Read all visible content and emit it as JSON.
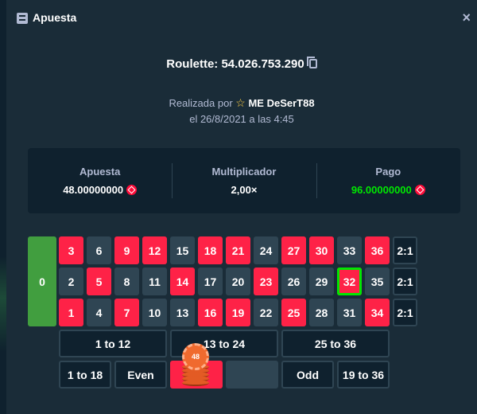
{
  "header": {
    "title": "Apuesta",
    "close_symbol": "×"
  },
  "game": {
    "line": "Roulette: 54.026.753.290"
  },
  "placed": {
    "prefix": "Realizada por",
    "user": "ME DeSerT88",
    "date": "el 26/8/2021 a las 4:45"
  },
  "stats": {
    "bet": {
      "label": "Apuesta",
      "value": "48.00000000"
    },
    "multiplier": {
      "label": "Multiplicador",
      "value": "2,00×"
    },
    "payout": {
      "label": "Pago",
      "value": "96.00000000"
    }
  },
  "table": {
    "zero": "0",
    "rows": [
      [
        {
          "n": "3",
          "c": "red"
        },
        {
          "n": "6",
          "c": "black"
        },
        {
          "n": "9",
          "c": "red"
        },
        {
          "n": "12",
          "c": "red"
        },
        {
          "n": "15",
          "c": "black"
        },
        {
          "n": "18",
          "c": "red"
        },
        {
          "n": "21",
          "c": "red"
        },
        {
          "n": "24",
          "c": "black"
        },
        {
          "n": "27",
          "c": "red"
        },
        {
          "n": "30",
          "c": "red"
        },
        {
          "n": "33",
          "c": "black"
        },
        {
          "n": "36",
          "c": "red"
        }
      ],
      [
        {
          "n": "2",
          "c": "black"
        },
        {
          "n": "5",
          "c": "red"
        },
        {
          "n": "8",
          "c": "black"
        },
        {
          "n": "11",
          "c": "black"
        },
        {
          "n": "14",
          "c": "red"
        },
        {
          "n": "17",
          "c": "black"
        },
        {
          "n": "20",
          "c": "black"
        },
        {
          "n": "23",
          "c": "red"
        },
        {
          "n": "26",
          "c": "black"
        },
        {
          "n": "29",
          "c": "black"
        },
        {
          "n": "32",
          "c": "red",
          "hit": true
        },
        {
          "n": "35",
          "c": "black"
        }
      ],
      [
        {
          "n": "1",
          "c": "red"
        },
        {
          "n": "4",
          "c": "black"
        },
        {
          "n": "7",
          "c": "red"
        },
        {
          "n": "10",
          "c": "black"
        },
        {
          "n": "13",
          "c": "black"
        },
        {
          "n": "16",
          "c": "red"
        },
        {
          "n": "19",
          "c": "red"
        },
        {
          "n": "22",
          "c": "black"
        },
        {
          "n": "25",
          "c": "red"
        },
        {
          "n": "28",
          "c": "black"
        },
        {
          "n": "31",
          "c": "black"
        },
        {
          "n": "34",
          "c": "red"
        }
      ]
    ],
    "column_label": "2:1",
    "dozens": [
      "1 to 12",
      "13 to 24",
      "25 to 36"
    ],
    "outside": [
      "1 to 18",
      "Even",
      "",
      "",
      "Odd",
      "19 to 36"
    ],
    "chip_value": "48"
  },
  "colors": {
    "red": "#fe2247",
    "black": "#2f4553",
    "green": "#419e3f",
    "win": "#00e701"
  }
}
